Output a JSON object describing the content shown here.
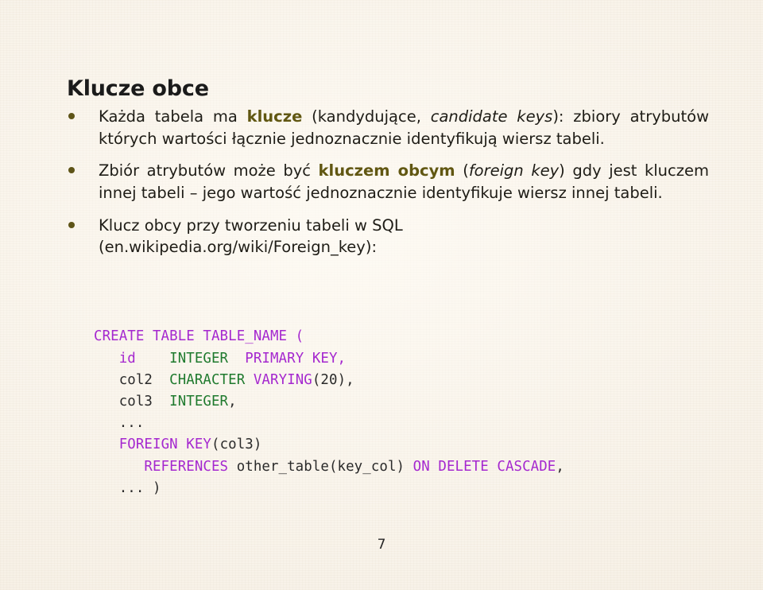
{
  "slide": {
    "title": "Klucze obce",
    "page_number": "7",
    "background_color": "#f7f1e7",
    "accent_color": "#615712",
    "bullet_color": "#5e5417",
    "text_color": "#1e1c16"
  },
  "bullets": [
    {
      "id": "bullet-keys",
      "segments": [
        {
          "text": "Każda tabela ma ",
          "style": "normal"
        },
        {
          "text": "klucze",
          "style": "bold-accent"
        },
        {
          "text": " (kandydujące, ",
          "style": "normal"
        },
        {
          "text": "candidate keys",
          "style": "italic"
        },
        {
          "text": "): zbiory atrybutów których wartości łącznie jednoznacznie identyfikują wiersz tabeli.",
          "style": "normal"
        }
      ],
      "plain": "Każda tabela ma klucze (kandydujące, candidate keys): zbiory atrybutów których wartości łącznie jednoznacznie identyfikują wiersz tabeli."
    },
    {
      "id": "bullet-foreign-key",
      "segments": [
        {
          "text": "Zbiór atrybutów może być ",
          "style": "normal"
        },
        {
          "text": "kluczem obcym",
          "style": "bold-accent"
        },
        {
          "text": " (",
          "style": "normal"
        },
        {
          "text": "foreign key",
          "style": "italic"
        },
        {
          "text": ") gdy jest kluczem innej tabeli – jego wartość jednoznacznie identyfikuje wiersz innej tabeli.",
          "style": "normal"
        }
      ],
      "plain": "Zbiór atrybutów może być kluczem obcym (foreign key) gdy jest kluczem innej tabeli – jego wartość jednoznacznie identyfikuje wiersz innej tabeli."
    },
    {
      "id": "bullet-sql-reference",
      "segments": [
        {
          "text": "Klucz obcy przy tworzeniu tabeli w SQL",
          "style": "normal"
        },
        {
          "text": "\n",
          "style": "break"
        },
        {
          "text": "(en.wikipedia.org/wiki/Foreign_key):",
          "style": "normal"
        }
      ],
      "plain": "Klucz obcy przy tworzeniu tabeli w SQL (en.wikipedia.org/wiki/Foreign_key):"
    }
  ],
  "code": {
    "language": "sql",
    "keyword_color": "#a528cf",
    "type_color": "#1f7a2e",
    "plain_color": "#2a2a2a",
    "lines": [
      [
        {
          "t": "CREATE TABLE TABLE_NAME (",
          "c": "kw"
        }
      ],
      [
        {
          "t": "   ",
          "c": "pl"
        },
        {
          "t": "id",
          "c": "kw"
        },
        {
          "t": "    ",
          "c": "pl"
        },
        {
          "t": "INTEGER",
          "c": "typ"
        },
        {
          "t": "  ",
          "c": "pl"
        },
        {
          "t": "PRIMARY KEY,",
          "c": "kw"
        }
      ],
      [
        {
          "t": "   col2  ",
          "c": "pl"
        },
        {
          "t": "CHARACTER",
          "c": "typ"
        },
        {
          "t": " ",
          "c": "pl"
        },
        {
          "t": "VARYING",
          "c": "kw"
        },
        {
          "t": "(20),",
          "c": "pl"
        }
      ],
      [
        {
          "t": "   col3  ",
          "c": "pl"
        },
        {
          "t": "INTEGER",
          "c": "typ"
        },
        {
          "t": ",",
          "c": "pl"
        }
      ],
      [
        {
          "t": "   ...",
          "c": "pl"
        }
      ],
      [
        {
          "t": "   ",
          "c": "pl"
        },
        {
          "t": "FOREIGN KEY",
          "c": "kw"
        },
        {
          "t": "(col3)",
          "c": "pl"
        }
      ],
      [
        {
          "t": "      ",
          "c": "pl"
        },
        {
          "t": "REFERENCES",
          "c": "kw"
        },
        {
          "t": " other_table(key_col) ",
          "c": "pl"
        },
        {
          "t": "ON DELETE CASCADE",
          "c": "kw"
        },
        {
          "t": ",",
          "c": "pl"
        }
      ],
      [
        {
          "t": "   ... )",
          "c": "pl"
        }
      ]
    ],
    "plain_text": "CREATE TABLE TABLE_NAME (\n   id    INTEGER  PRIMARY KEY,\n   col2  CHARACTER VARYING(20),\n   col3  INTEGER,\n   ...\n   FOREIGN KEY(col3)\n      REFERENCES other_table(key_col) ON DELETE CASCADE,\n   ... )"
  }
}
